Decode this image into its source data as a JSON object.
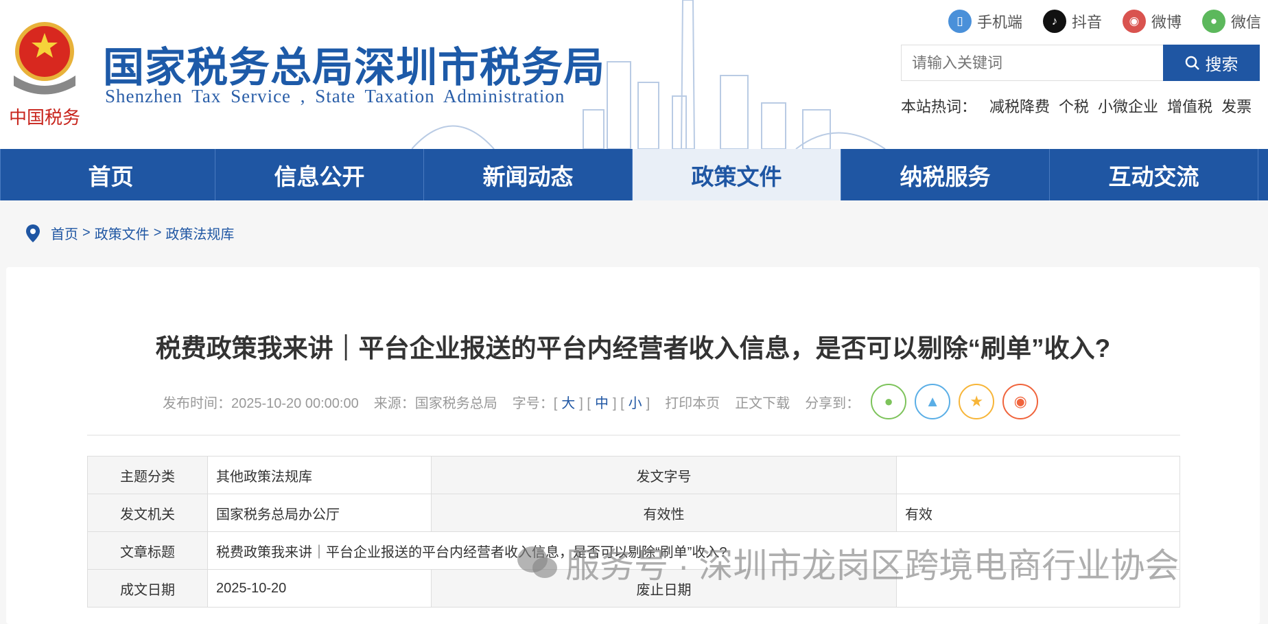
{
  "header": {
    "title_cn": "国家税务总局深圳市税务局",
    "title_en": "Shenzhen Tax Service , State Taxation Administration",
    "emblem_text": "中国税务",
    "social": [
      {
        "label": "手机端",
        "icon": "mobile-icon",
        "color": "#4a90d9"
      },
      {
        "label": "抖音",
        "icon": "douyin-icon",
        "color": "#111111"
      },
      {
        "label": "微博",
        "icon": "weibo-icon",
        "color": "#d9534f"
      },
      {
        "label": "微信",
        "icon": "wechat-icon",
        "color": "#5cb85c"
      }
    ],
    "search": {
      "placeholder": "请输入关键词",
      "button": "搜索"
    },
    "hot": {
      "label": "本站热词：",
      "items": [
        "减税降费",
        "个税",
        "小微企业",
        "增值税",
        "发票"
      ]
    }
  },
  "nav": [
    {
      "label": "首页"
    },
    {
      "label": "信息公开"
    },
    {
      "label": "新闻动态"
    },
    {
      "label": "政策文件",
      "active": true
    },
    {
      "label": "纳税服务"
    },
    {
      "label": "互动交流"
    }
  ],
  "breadcrumb": [
    "首页",
    "政策文件",
    "政策法规库"
  ],
  "article": {
    "title": "税费政策我来讲｜平台企业报送的平台内经营者收入信息，是否可以剔除“刷单”收入?",
    "publish": "发布时间：2025-10-20 00:00:00",
    "source": "来源：国家税务总局",
    "fontsize_label": "字号：",
    "sizes": [
      "大",
      "中",
      "小"
    ],
    "print": "打印本页",
    "download": "正文下载",
    "share": "分享到："
  },
  "info_table": [
    [
      "主题分类",
      "其他政策法规库",
      "发文字号",
      ""
    ],
    [
      "发文机关",
      "国家税务总局办公厅",
      "有效性",
      "有效"
    ],
    [
      "文章标题",
      "税费政策我来讲｜平台企业报送的平台内经营者收入信息，是否可以剔除“刷单”收入?"
    ],
    [
      "成文日期",
      "2025-10-20",
      "废止日期",
      ""
    ]
  ],
  "watermark": "服务号 · 深圳市龙岗区跨境电商行业协会",
  "colors": {
    "brand": "#1f56a3",
    "bg": "#f6f6f6"
  }
}
